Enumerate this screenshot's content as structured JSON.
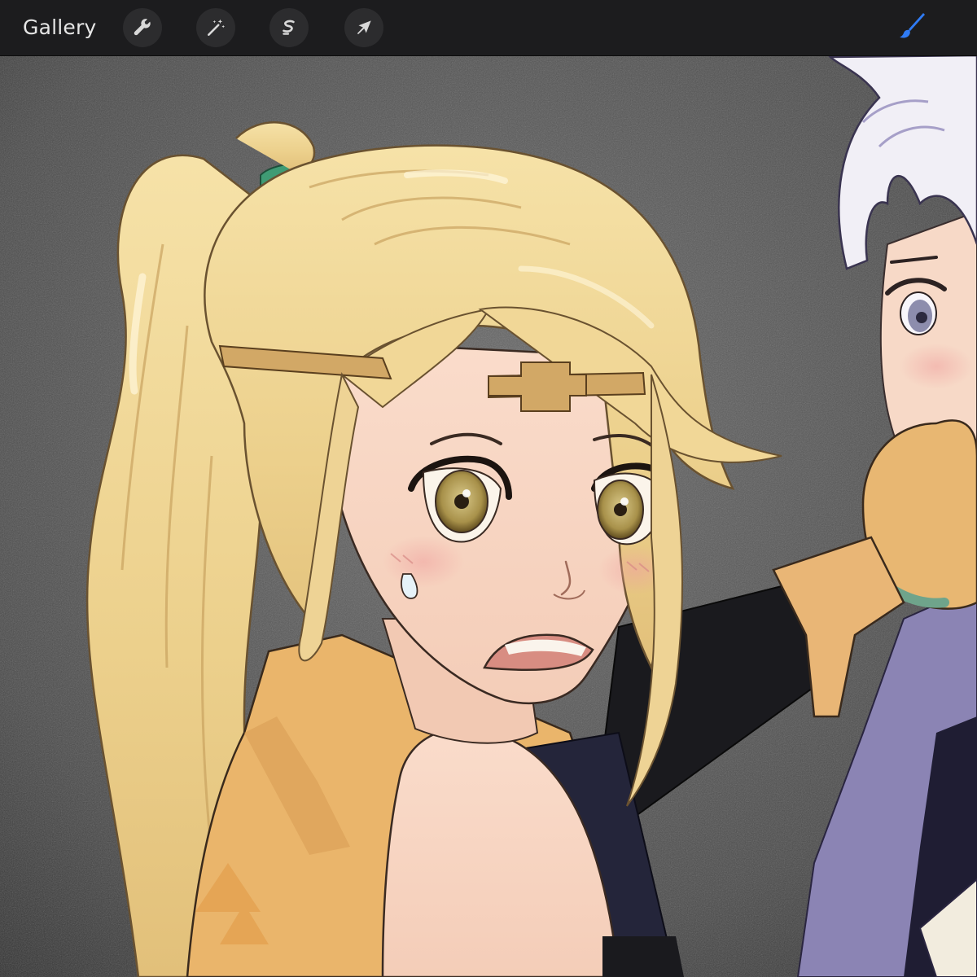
{
  "toolbar": {
    "gallery_label": "Gallery",
    "tools": [
      {
        "name": "actions",
        "icon": "wrench-icon"
      },
      {
        "name": "adjustments",
        "icon": "magic-wand-icon"
      },
      {
        "name": "selection",
        "icon": "selection-s-icon"
      },
      {
        "name": "transform",
        "icon": "arrow-cursor-icon"
      }
    ],
    "active_tool": {
      "name": "brush",
      "icon": "brush-icon",
      "color": "#2f7bf5"
    }
  },
  "canvas": {
    "background_color": "#555555",
    "content": "illustration"
  }
}
